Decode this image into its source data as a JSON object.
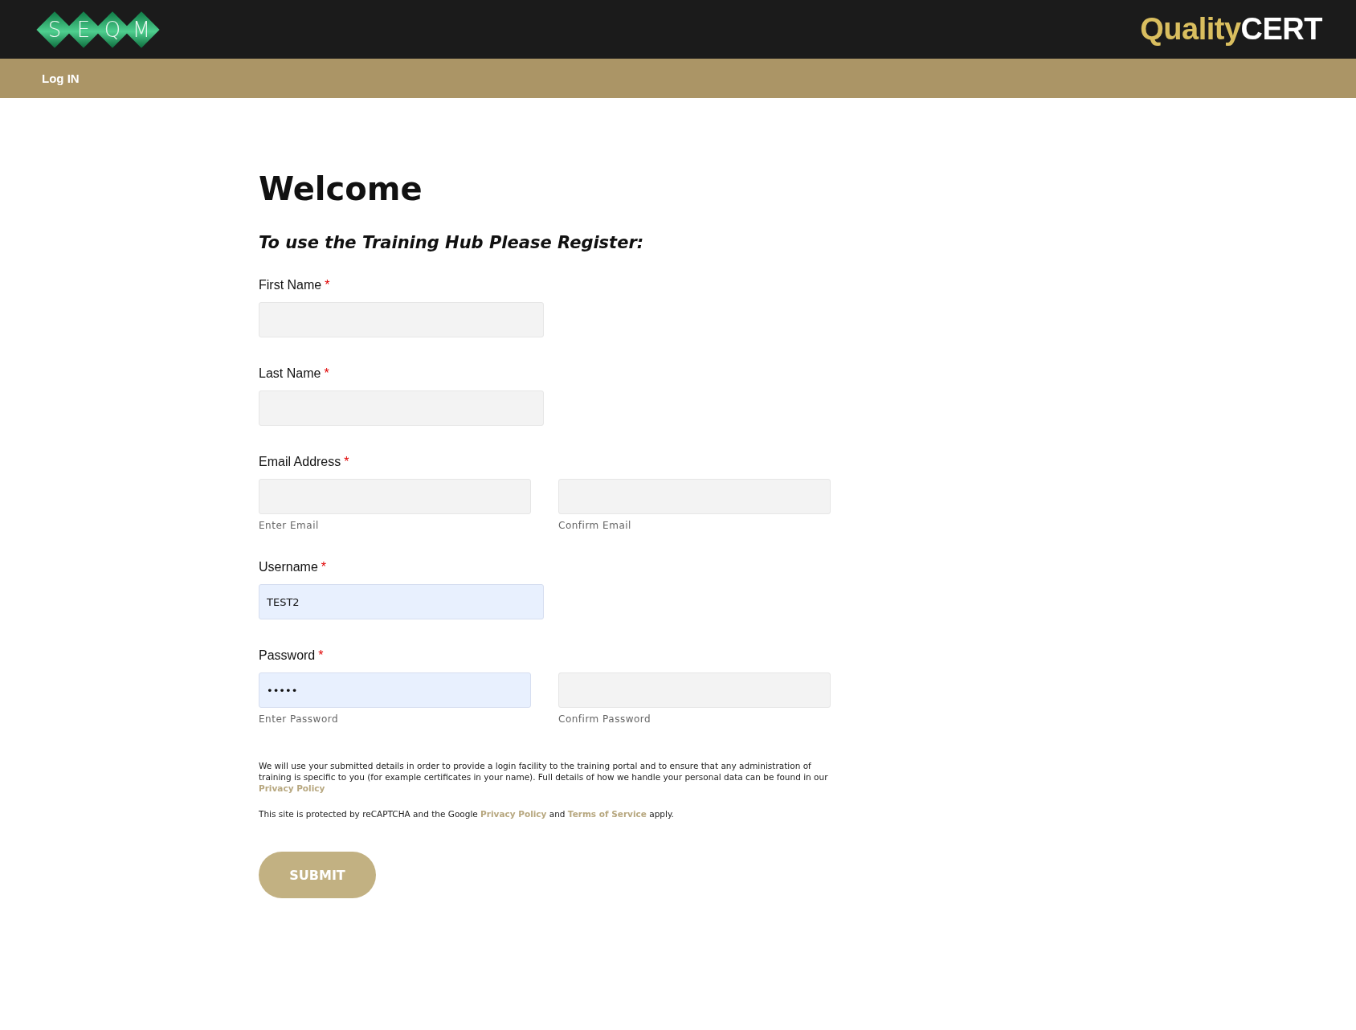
{
  "header": {
    "logo_letters": [
      "S",
      "E",
      "Q",
      "M"
    ],
    "brand": {
      "first": "Quality",
      "second": "CERT"
    }
  },
  "nav": {
    "items": [
      {
        "label": "Log IN"
      }
    ]
  },
  "form": {
    "title": "Welcome",
    "subtitle": "To use the Training Hub Please Register:",
    "fields": [
      {
        "kind": "single",
        "label": "First Name",
        "required_mark": "*",
        "inputs": [
          {
            "autofilled": false
          }
        ]
      },
      {
        "kind": "single",
        "label": "Last Name",
        "required_mark": "*",
        "inputs": [
          {
            "autofilled": false
          }
        ]
      },
      {
        "kind": "pair",
        "label": "Email Address",
        "required_mark": "*",
        "inputs": [
          {
            "autofilled": false,
            "caption": "Enter Email"
          },
          {
            "autofilled": false,
            "caption": "Confirm Email"
          }
        ]
      },
      {
        "kind": "single",
        "label": "Username",
        "required_mark": "*",
        "inputs": [
          {
            "value": "TEST2",
            "autofilled": true
          }
        ]
      },
      {
        "kind": "pair",
        "label": "Password",
        "required_mark": "*",
        "inputs": [
          {
            "value": "•••••",
            "autofilled": true,
            "caption": "Enter Password"
          },
          {
            "autofilled": false,
            "caption": "Confirm Password"
          }
        ]
      }
    ],
    "notices": [
      [
        {
          "text": "We will use your submitted details in order to provide a login facility to the training portal and to ensure that any administration of training is specific to you (for example certificates in your name). Full details of how we handle your personal data can be found in our "
        },
        {
          "link": "Privacy Policy"
        }
      ],
      [
        {
          "text": "This site is protected by reCAPTCHA and the Google "
        },
        {
          "link": "Privacy Policy"
        },
        {
          "text": " and "
        },
        {
          "link": "Terms of Service"
        },
        {
          "text": " apply."
        }
      ]
    ],
    "submit": "SUBMIT"
  }
}
